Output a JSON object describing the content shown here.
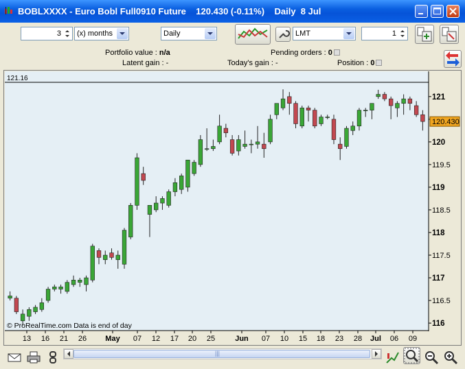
{
  "window": {
    "title": "BOBLXXXX - Euro Bobl Full0910 Future    120.430 (-0.11%)    Daily  8 Jul"
  },
  "toolbar": {
    "period_count": "3",
    "period_unit": "(x) months",
    "interval": "Daily",
    "order_type": "LMT",
    "quantity": "1"
  },
  "info": {
    "portfolio_label": "Portfolio value :",
    "portfolio_value": "n/a",
    "pending_label": "Pending orders :",
    "pending_value": "0",
    "latent_label": "Latent gain :",
    "latent_value": "-",
    "today_label": "Today's gain :",
    "today_value": "-",
    "position_label": "Position :",
    "position_value": "0"
  },
  "chart": {
    "top_level_label": "121.16",
    "current_price_label": "120.430",
    "footer_text": "© ProRealTime.com Data is end of day",
    "colors": {
      "up": "#3aa636",
      "down": "#c24850",
      "background": "#e5eff5",
      "price_tag": "#f0a520"
    }
  },
  "chart_data": {
    "type": "candlestick",
    "y_ticks": [
      "121",
      "120.5",
      "120",
      "119.5",
      "119",
      "118.5",
      "118",
      "117.5",
      "117",
      "116.5",
      "116"
    ],
    "x_ticks": [
      "13",
      "16",
      "21",
      "26",
      "May",
      "07",
      "12",
      "17",
      "20",
      "25",
      "Jun",
      "07",
      "10",
      "15",
      "18",
      "23",
      "28",
      "Jul",
      "06",
      "09"
    ],
    "ylim": [
      115.85,
      121.3
    ],
    "candles": [
      [
        116.55,
        116.7,
        116.5,
        116.6
      ],
      [
        116.55,
        116.6,
        116.2,
        116.25
      ],
      [
        116.05,
        116.3,
        115.95,
        116.2
      ],
      [
        116.15,
        116.35,
        116.05,
        116.3
      ],
      [
        116.25,
        116.4,
        116.2,
        116.35
      ],
      [
        116.3,
        116.55,
        116.25,
        116.45
      ],
      [
        116.5,
        116.8,
        116.45,
        116.75
      ],
      [
        116.75,
        116.85,
        116.7,
        116.8
      ],
      [
        116.75,
        116.85,
        116.65,
        116.8
      ],
      [
        116.7,
        116.95,
        116.65,
        116.9
      ],
      [
        116.85,
        117.05,
        116.8,
        116.95
      ],
      [
        116.9,
        117.0,
        116.8,
        116.95
      ],
      [
        116.85,
        117.05,
        116.7,
        117.0
      ],
      [
        116.95,
        117.75,
        116.9,
        117.7
      ],
      [
        117.6,
        117.65,
        117.3,
        117.45
      ],
      [
        117.4,
        117.6,
        117.3,
        117.5
      ],
      [
        117.55,
        117.65,
        117.4,
        117.45
      ],
      [
        117.4,
        117.6,
        117.2,
        117.5
      ],
      [
        117.3,
        118.1,
        117.2,
        118.05
      ],
      [
        117.9,
        118.65,
        117.85,
        118.6
      ],
      [
        118.6,
        119.75,
        118.5,
        119.65
      ],
      [
        119.3,
        119.45,
        119.05,
        119.15
      ],
      [
        118.4,
        118.55,
        117.9,
        118.6
      ],
      [
        118.5,
        118.8,
        118.45,
        118.65
      ],
      [
        118.65,
        118.8,
        118.5,
        118.75
      ],
      [
        118.6,
        118.95,
        118.55,
        118.9
      ],
      [
        118.9,
        119.2,
        118.8,
        119.1
      ],
      [
        118.95,
        119.3,
        118.85,
        119.25
      ],
      [
        119.0,
        119.35,
        118.9,
        119.6
      ],
      [
        119.3,
        119.6,
        119.25,
        119.55
      ],
      [
        119.5,
        120.15,
        119.45,
        120.05
      ],
      [
        119.85,
        120.3,
        119.8,
        119.85
      ],
      [
        119.85,
        120.05,
        119.8,
        119.9
      ],
      [
        120.0,
        120.6,
        119.95,
        120.35
      ],
      [
        120.3,
        120.4,
        120.1,
        120.2
      ],
      [
        120.05,
        120.15,
        119.7,
        119.75
      ],
      [
        119.8,
        120.15,
        119.7,
        120.05
      ],
      [
        119.9,
        120.25,
        119.85,
        119.95
      ],
      [
        119.95,
        120.05,
        119.75,
        119.95
      ],
      [
        119.95,
        120.35,
        119.85,
        120.0
      ],
      [
        119.95,
        120.2,
        119.65,
        119.85
      ],
      [
        120.0,
        120.6,
        119.95,
        120.5
      ],
      [
        120.6,
        120.85,
        120.5,
        120.85
      ],
      [
        120.75,
        121.16,
        120.7,
        120.95
      ],
      [
        121.0,
        121.1,
        120.6,
        120.85
      ],
      [
        120.85,
        120.9,
        120.3,
        120.4
      ],
      [
        120.35,
        120.8,
        120.3,
        120.75
      ],
      [
        120.75,
        120.8,
        120.45,
        120.7
      ],
      [
        120.7,
        120.75,
        120.3,
        120.35
      ],
      [
        120.4,
        120.6,
        120.35,
        120.55
      ],
      [
        120.55,
        120.6,
        120.5,
        120.55
      ],
      [
        120.5,
        120.6,
        119.95,
        120.05
      ],
      [
        119.95,
        120.1,
        119.6,
        119.85
      ],
      [
        119.9,
        120.35,
        119.85,
        120.3
      ],
      [
        120.25,
        120.45,
        120.15,
        120.35
      ],
      [
        120.35,
        120.75,
        120.25,
        120.7
      ],
      [
        120.7,
        120.75,
        120.55,
        120.7
      ],
      [
        120.7,
        120.85,
        120.5,
        120.85
      ],
      [
        121.0,
        121.15,
        120.95,
        121.05
      ],
      [
        121.05,
        121.1,
        120.9,
        120.95
      ],
      [
        120.95,
        121.0,
        120.5,
        120.8
      ],
      [
        120.75,
        120.9,
        120.55,
        120.85
      ],
      [
        120.85,
        121.05,
        120.6,
        120.95
      ],
      [
        120.95,
        121.0,
        120.7,
        120.85
      ],
      [
        120.8,
        120.9,
        120.55,
        120.6
      ],
      [
        120.6,
        120.7,
        120.25,
        120.45
      ]
    ]
  },
  "bottom": {
    "scroll_grip": "|||"
  }
}
